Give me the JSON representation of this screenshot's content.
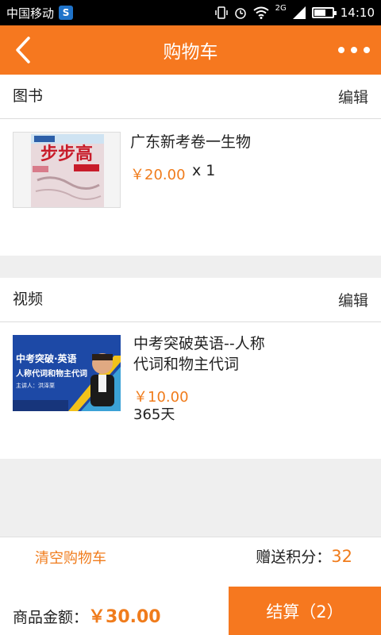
{
  "status": {
    "carrier": "中国移动",
    "sim_badge": "S",
    "network": "2G",
    "time": "14:10"
  },
  "header": {
    "title": "购物车",
    "back_icon": "chevron-left-icon",
    "more_icon": "more-dots-icon"
  },
  "books": {
    "title": "图书",
    "edit_label": "编辑",
    "item": {
      "name": "广东新考卷一生物",
      "price": "￥20.00",
      "qty": "x 1",
      "cover_text": "步步高"
    }
  },
  "videos": {
    "title": "视频",
    "edit_label": "编辑",
    "item": {
      "name_line1": "中考突破英语--人称",
      "name_line2": "代词和物主代词",
      "price": "￥10.00",
      "duration": "365天",
      "thumb_title1": "中考突破·英语",
      "thumb_title2": "人称代词和物主代词",
      "thumb_speaker": "主讲人：洪泽栗"
    }
  },
  "footer": {
    "clear_label": "清空购物车",
    "points_label": "赠送积分：",
    "points_value": "32",
    "total_label": "商品金额：",
    "total_value": "￥30.00",
    "checkout_label": "结算（2）"
  },
  "colors": {
    "accent": "#f6781f",
    "price": "#f07c1c"
  }
}
